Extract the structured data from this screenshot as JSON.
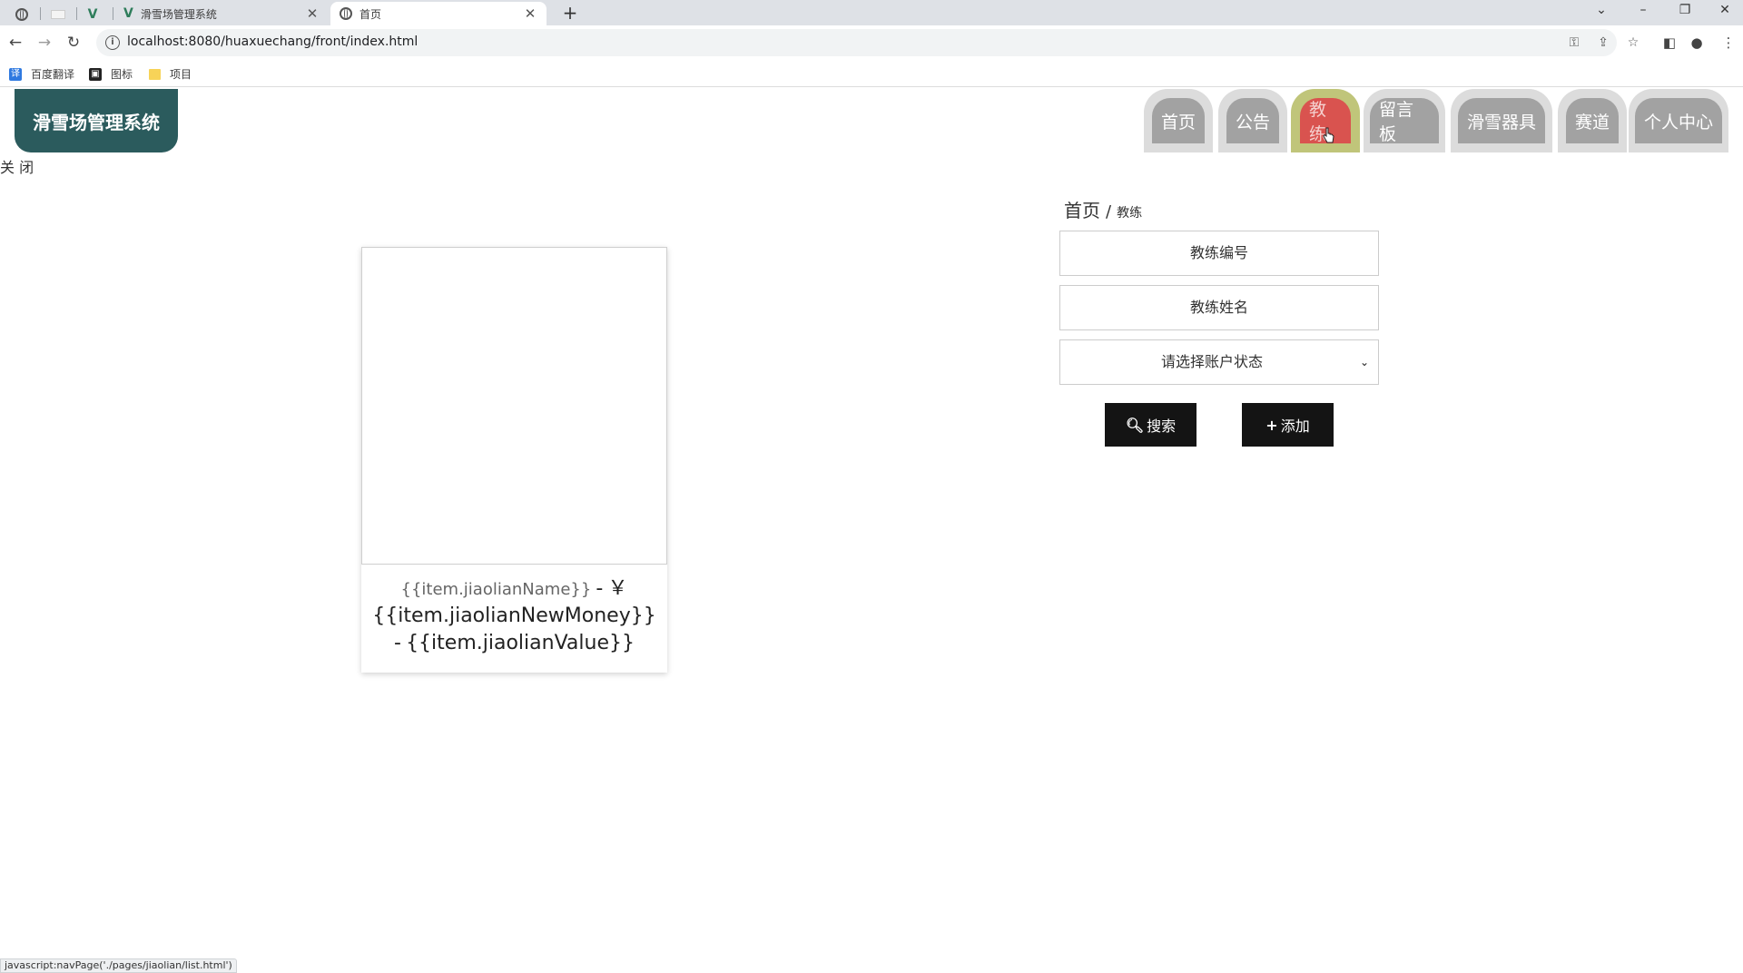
{
  "browser": {
    "tabs": [
      {
        "title": "",
        "icon": "globe-icon",
        "pinned": true
      },
      {
        "title": "",
        "icon": "blank-page-icon",
        "pinned": true
      },
      {
        "title": "",
        "icon": "vue-logo-icon",
        "pinned": true
      },
      {
        "title": "滑雪场管理系统",
        "icon": "vue-logo-icon",
        "active": false
      },
      {
        "title": "首页",
        "icon": "globe-icon",
        "active": true
      }
    ],
    "url": "localhost:8080/huaxuechang/front/index.html",
    "bookmarks": [
      {
        "label": "百度翻译",
        "icon": "baidu-translate-icon"
      },
      {
        "label": "图标",
        "icon": "bookmark-dark-icon"
      },
      {
        "label": "项目",
        "icon": "folder-icon"
      }
    ],
    "status_url": "javascript:navPage('./pages/jiaolian/list.html')"
  },
  "site": {
    "logo_text": "滑雪场管理系统",
    "close_label": "关 闭"
  },
  "nav": {
    "items": [
      {
        "label": "首页",
        "active": false
      },
      {
        "label": "公告",
        "active": false
      },
      {
        "label": "教练",
        "active": true
      },
      {
        "label": "留言板",
        "active": false
      },
      {
        "label": "滑雪器具",
        "active": false
      },
      {
        "label": "赛道",
        "active": false
      },
      {
        "label": "个人中心",
        "active": false
      }
    ]
  },
  "breadcrumb": {
    "home": "首页",
    "separator": "/",
    "current": "教练"
  },
  "search": {
    "code_placeholder": "教练编号",
    "name_placeholder": "教练姓名",
    "status_select": "请选择账户状态",
    "search_label": "搜索",
    "add_label": "添加"
  },
  "card": {
    "name": "{{item.jiaolianName}}",
    "dash1": "-",
    "currency": "￥",
    "money": "{{item.jiaolianNewMoney}}",
    "dash2": "-",
    "value": "{{item.jiaolianValue}}"
  },
  "colors": {
    "logo_bg": "#2b5b5d",
    "nav_inner": "#a2a2a2",
    "nav_active": "#d9534f",
    "button_bg": "#141414"
  }
}
